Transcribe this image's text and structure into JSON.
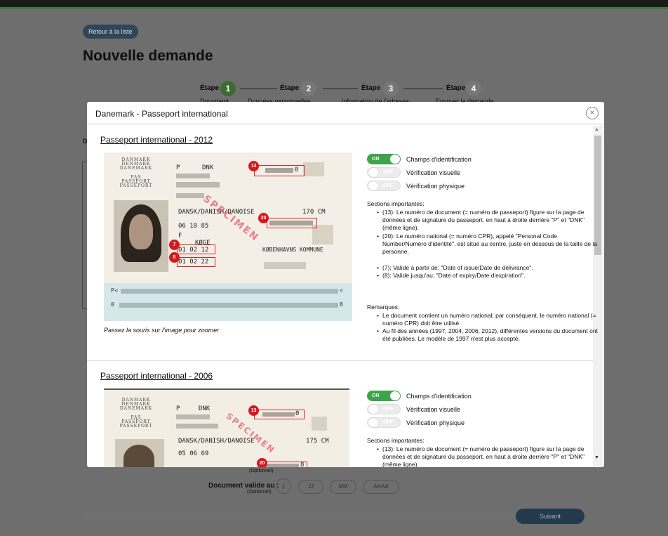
{
  "page": {
    "back_button": "Retour à la liste",
    "title": "Nouvelle demande",
    "left_letter": "D",
    "steps": [
      {
        "label": "Étape",
        "num": "1",
        "sub": "Document",
        "active": true
      },
      {
        "label": "Étape",
        "num": "2",
        "sub": "Données personnelles",
        "active": false
      },
      {
        "label": "Étape",
        "num": "3",
        "sub": "Information de l'adresse",
        "active": false
      },
      {
        "label": "Étape",
        "num": "4",
        "sub": "Envoyer la demande",
        "active": false
      }
    ],
    "optional_top": "(Optionnel)",
    "valid_label": "Document valide au :",
    "valid_optional": "(Optionnel)",
    "info_icon": "i",
    "date_fields": [
      "JJ",
      "MM",
      "AAAA"
    ],
    "next_button": "Suivant"
  },
  "modal": {
    "title": "Danemark - Passeport international",
    "close_icon": "×",
    "scroll_up": "▲",
    "scroll_down": "▼",
    "cards": [
      {
        "title": "Passeport international - 2012",
        "zoom_note": "Passez la souris sur l'image pour zoomer",
        "toggles": [
          {
            "state": "ON",
            "label": "Champs d'identification"
          },
          {
            "state": "OFF",
            "label": "Vérification visuelle"
          },
          {
            "state": "OFF",
            "label": "Vérification physique"
          }
        ],
        "sections_heading": "Sections importantes:",
        "sections": [
          "(13): Le numéro de document (= numéro de passeport) figure sur la page de données et de signature du passeport, en haut à droite derrière \"P\" et \"DNK\" (même ligne).",
          "(20): Le numéro national (= numéro CPR), appelé \"Personal Code Number/Numéro d'identité\", est situé au centre, juste en dessous de la taille de la personne.",
          "(7): Valide à partir de: \"Date of issue/Date de délivrance\".",
          "(8): Valide jusqu'au: \"Date of expiry/Date d'expiration\"."
        ],
        "remarks_heading": "Remarques:",
        "remarks": [
          "Le document contient un numéro national; par conséquent, le numéro national (= numéro CPR) doit être utilisé.",
          "Au fil des années (1997, 2004, 2006, 2012), différentes versions du document ont été publiées. Le modèle de 1997 n'est plus accepté."
        ],
        "passport": {
          "country_block": "DANMARK\nDENMARK\nDANEMARK",
          "doc_block": "PAS\nPASSPORT\nPASSEPORT",
          "type": "P",
          "code": "DNK",
          "doc_number": "0",
          "nationality": "DANSK/DANISH/DANOISE",
          "height": "170 CM",
          "birth_date": "06 10 85",
          "sex": "F",
          "birth_place": "KØGE",
          "issue_date": "01 02 12",
          "expiry_date": "01 02 22",
          "authority": "KØBENHAVNS KOMMUNE",
          "specimen": "SPECIMEN",
          "mrz_line1_start": "P<",
          "mrz_line1_end": "<",
          "mrz_line2_start": "0",
          "mrz_line2_end": "8",
          "badges": [
            "13",
            "20",
            "7",
            "8"
          ]
        }
      },
      {
        "title": "Passeport international - 2006",
        "toggles": [
          {
            "state": "ON",
            "label": "Champs d'identification"
          },
          {
            "state": "OFF",
            "label": "Vérification visuelle"
          },
          {
            "state": "OFF",
            "label": "Vérification physique"
          }
        ],
        "sections_heading": "Sections importantes:",
        "sections": [
          "(13): Le numéro de document (= numéro de passeport) figure sur la page de données et de signature du passeport, en haut à droite derrière \"P\" et \"DNK\" (même ligne)."
        ],
        "passport": {
          "country_block": "DANMARK\nDENMARK\nDANEMARK",
          "doc_block": "PAS\nPASSPORT\nPASSEPORT",
          "type": "P",
          "code": "DNK",
          "doc_number": "0",
          "nationality": "DANSK/DANISH/DANOISE",
          "height": "175 CM",
          "birth_date": "05 06 69",
          "number_end": "8",
          "specimen": "SPECIMEN",
          "badges": [
            "13",
            "20"
          ]
        }
      }
    ]
  }
}
